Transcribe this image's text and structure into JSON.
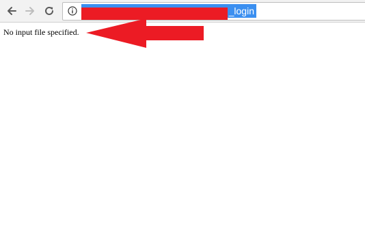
{
  "browser": {
    "address_bar": {
      "url_visible_text": "_login",
      "url_selected": true,
      "redacted": true
    },
    "icons": {
      "back": "back-arrow-icon",
      "forward": "forward-arrow-icon",
      "reload": "reload-icon",
      "site_info": "info-icon"
    }
  },
  "page": {
    "message": "No input file specified."
  },
  "annotation": {
    "arrow_color": "#ec1b24",
    "redaction_color": "#ec1b24",
    "selection_color": "#3b8ff0"
  }
}
